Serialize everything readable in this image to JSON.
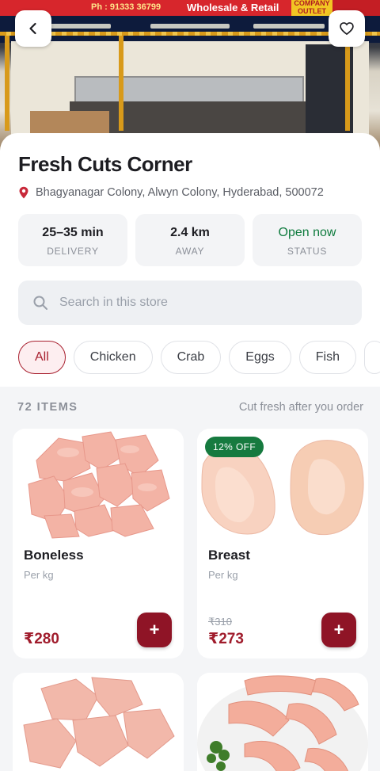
{
  "hero": {
    "sign_phone": "Ph : 91333 36799",
    "sign_retail": "Wholesale & Retail",
    "sign_outlet_1": "COMPANY",
    "sign_outlet_2": "OUTLET",
    "back_icon": "chevron-left-icon",
    "favorite_icon": "heart-icon"
  },
  "store": {
    "name": "Fresh Cuts Corner",
    "address": "Bhagyanagar Colony, Alwyn Colony, Hyderabad, 500072",
    "address_icon": "location-pin-icon"
  },
  "stats": [
    {
      "value": "25–35 min",
      "label": "DELIVERY"
    },
    {
      "value": "2.4 km",
      "label": "AWAY"
    },
    {
      "value": "Open now",
      "label": "STATUS"
    }
  ],
  "search": {
    "placeholder": "Search in this store",
    "icon": "search-icon"
  },
  "categories": [
    "All",
    "Chicken",
    "Crab",
    "Eggs",
    "Fish"
  ],
  "active_category": "All",
  "items_header": {
    "count": "72 ITEMS",
    "note": "Cut fresh after you order"
  },
  "products": [
    {
      "name": "Boneless",
      "unit": "Per kg",
      "price": "₹280",
      "old_price": "",
      "badge": ""
    },
    {
      "name": "Breast",
      "unit": "Per kg",
      "price": "₹273",
      "old_price": "₹310",
      "badge": "12% OFF"
    },
    {
      "name": "",
      "unit": "",
      "price": "",
      "old_price": "",
      "badge": ""
    },
    {
      "name": "",
      "unit": "",
      "price": "",
      "old_price": "",
      "badge": ""
    }
  ],
  "add_label": "+",
  "colors": {
    "accent": "#8f1426",
    "active_chip": "#a8202f",
    "open_green": "#0f7b3e",
    "badge_green": "#167a3f"
  }
}
